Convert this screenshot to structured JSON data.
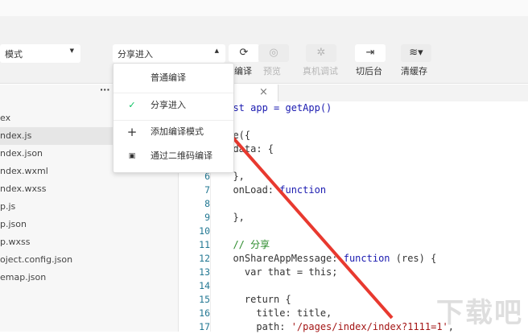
{
  "toolbar": {
    "mode_select": "模式",
    "compile_select": "分享进入",
    "buttons": [
      {
        "label": "编译",
        "icon": "refresh-icon",
        "enabled": true
      },
      {
        "label": "预览",
        "icon": "eye-icon",
        "enabled": false
      },
      {
        "label": "真机调试",
        "icon": "bug-icon",
        "enabled": false
      },
      {
        "label": "切后台",
        "icon": "switch-background-icon",
        "enabled": true
      },
      {
        "label": "清缓存",
        "icon": "layers-icon",
        "enabled": true
      }
    ]
  },
  "dropdown": {
    "items": [
      {
        "label": "普通编译",
        "icon": ""
      },
      {
        "label": "分享进入",
        "icon": "✓",
        "checked": true
      },
      {
        "label": "添加编译模式",
        "icon": "+"
      },
      {
        "label": "通过二维码编译",
        "icon": "qr"
      }
    ]
  },
  "sidebar": {
    "more": "···",
    "files": [
      "ex",
      "ndex.js",
      "ndex.json",
      "ndex.wxml",
      "ndex.wxss",
      "p.js",
      "p.json",
      "p.wxss",
      "oject.config.json",
      "emap.json"
    ]
  },
  "editor": {
    "close": "×",
    "line_numbers": [
      "6",
      "7",
      "8",
      "9",
      "10",
      "11",
      "12",
      "13",
      "14",
      "15",
      "16",
      "17"
    ],
    "lines": [
      {
        "html": "onst app = getApp()"
      },
      {
        "t": ""
      },
      {
        "t": "age({"
      },
      {
        "t": "  data: {"
      },
      {
        "t": ""
      },
      {
        "t": "  },"
      },
      {
        "a": "  onLoad: ",
        "k": "function",
        " b": ""
      },
      {
        "t": ""
      },
      {
        "t": "  },"
      },
      {
        "t": ""
      },
      {
        "c": "  // 分享"
      },
      {
        "a": "  onShareAppMessage: ",
        "k": "function",
        "b": " (res) {"
      },
      {
        "t": "    var that = this;"
      },
      {
        "t": ""
      },
      {
        "t": "    return {"
      },
      {
        "t": "      title: title,"
      },
      {
        "a": "      path: ",
        "s": "'/pages/index/index?1111=1'",
        "b": ","
      }
    ]
  },
  "watermark": "下载吧",
  "colors": {
    "accent": "#07c160",
    "arrow": "#e8392f"
  }
}
